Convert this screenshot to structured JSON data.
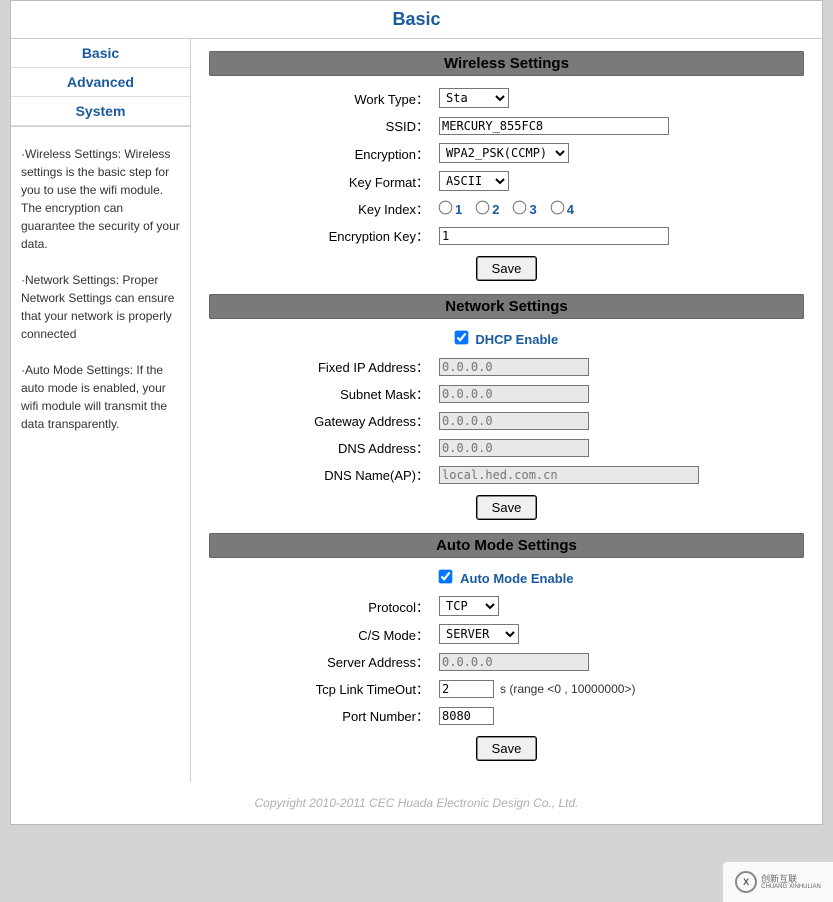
{
  "header": {
    "title": "Basic"
  },
  "nav": {
    "items": [
      "Basic",
      "Advanced",
      "System"
    ]
  },
  "help": {
    "p1": "·Wireless Settings: Wireless settings is the basic step for you to use the wifi module. The encryption can guarantee the security of your data.",
    "p2": "·Network Settings: Proper Network Settings can ensure that your network is properly connected",
    "p3": "·Auto Mode Settings: If the auto mode is enabled, your wifi module will transmit the data transparently."
  },
  "sections": {
    "wireless": {
      "title": "Wireless Settings",
      "fields": {
        "work_type": {
          "label": "Work Type：",
          "value": "Sta"
        },
        "ssid": {
          "label": "SSID：",
          "value": "MERCURY_855FC8"
        },
        "encryption": {
          "label": "Encryption：",
          "value": "WPA2_PSK(CCMP)"
        },
        "key_format": {
          "label": "Key Format：",
          "value": "ASCII"
        },
        "key_index": {
          "label": "Key Index：",
          "opts": [
            "1",
            "2",
            "3",
            "4"
          ]
        },
        "encryption_key": {
          "label": "Encryption Key：",
          "value": "1"
        }
      },
      "save": "Save"
    },
    "network": {
      "title": "Network Settings",
      "dhcp": {
        "label": "DHCP Enable",
        "checked": true
      },
      "fields": {
        "fixed_ip": {
          "label": "Fixed IP Address：",
          "placeholder": "0.0.0.0"
        },
        "subnet": {
          "label": "Subnet Mask：",
          "placeholder": "0.0.0.0"
        },
        "gateway": {
          "label": "Gateway Address：",
          "placeholder": "0.0.0.0"
        },
        "dns": {
          "label": "DNS Address：",
          "placeholder": "0.0.0.0"
        },
        "dns_name": {
          "label": "DNS Name(AP)：",
          "placeholder": "local.hed.com.cn"
        }
      },
      "save": "Save"
    },
    "auto": {
      "title": "Auto Mode Settings",
      "enable": {
        "label": "Auto Mode Enable",
        "checked": true
      },
      "fields": {
        "protocol": {
          "label": "Protocol：",
          "value": "TCP"
        },
        "cs_mode": {
          "label": "C/S Mode：",
          "value": "SERVER"
        },
        "server_addr": {
          "label": "Server Address：",
          "placeholder": "0.0.0.0"
        },
        "timeout": {
          "label": "Tcp Link TimeOut：",
          "value": "2",
          "hint": "s (range <0 , 10000000>)"
        },
        "port": {
          "label": "Port Number：",
          "value": "8080"
        }
      },
      "save": "Save"
    }
  },
  "footer": {
    "text": "Copyright 2010-2011 CEC Huada Electronic Design Co., Ltd."
  },
  "watermark": {
    "brand": "创新互联",
    "sub": "CHUANG XINHULIAN"
  }
}
